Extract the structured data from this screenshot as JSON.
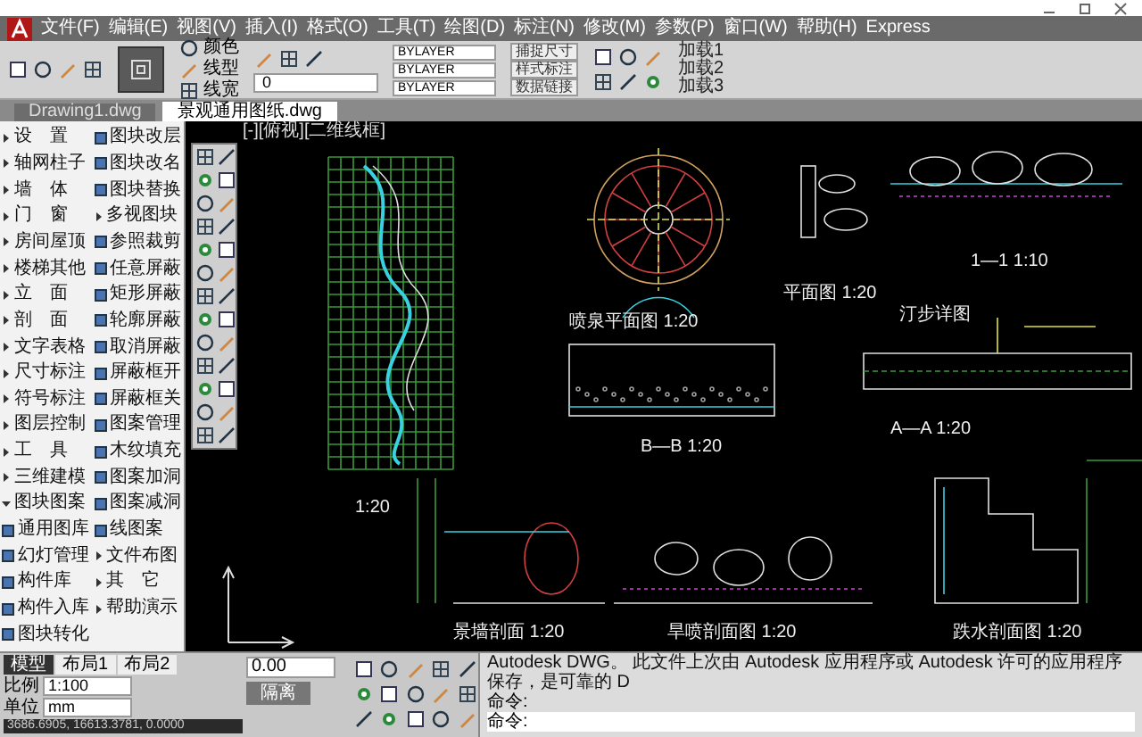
{
  "menu": [
    {
      "label": "文件(F)"
    },
    {
      "label": "编辑(E)"
    },
    {
      "label": "视图(V)"
    },
    {
      "label": "插入(I)"
    },
    {
      "label": "格式(O)"
    },
    {
      "label": "工具(T)"
    },
    {
      "label": "绘图(D)"
    },
    {
      "label": "标注(N)"
    },
    {
      "label": "修改(M)"
    },
    {
      "label": "参数(P)"
    },
    {
      "label": "窗口(W)"
    },
    {
      "label": "帮助(H)"
    },
    {
      "label": "Express"
    }
  ],
  "toolbar": {
    "properties": [
      "颜色",
      "线型",
      "线宽"
    ],
    "layer": "0",
    "linetypes": [
      "BYLAYER",
      "BYLAYER",
      "BYLAYER"
    ],
    "dim_buttons": [
      "捕捉尺寸",
      "样式标注",
      "数据链接"
    ],
    "loads": [
      "加载1",
      "加载2",
      "加载3"
    ]
  },
  "doc_tabs": [
    {
      "label": "Drawing1.dwg",
      "selected": false
    },
    {
      "label": "景观通用图纸.dwg",
      "selected": true
    }
  ],
  "viewport_label": "[-][俯视][二维线框]",
  "sidebar": {
    "items": [
      {
        "label": "设　置",
        "kind": "menu",
        "expanded": false
      },
      {
        "label": "轴网柱子",
        "kind": "menu",
        "expanded": false
      },
      {
        "label": "墙　体",
        "kind": "menu",
        "expanded": false
      },
      {
        "label": "门　窗",
        "kind": "menu",
        "expanded": false
      },
      {
        "label": "房间屋顶",
        "kind": "menu",
        "expanded": false
      },
      {
        "label": "楼梯其他",
        "kind": "menu",
        "expanded": false
      },
      {
        "label": "立　面",
        "kind": "menu",
        "expanded": false
      },
      {
        "label": "剖　面",
        "kind": "menu",
        "expanded": false
      },
      {
        "label": "文字表格",
        "kind": "menu",
        "expanded": false
      },
      {
        "label": "尺寸标注",
        "kind": "menu",
        "expanded": false
      },
      {
        "label": "符号标注",
        "kind": "menu",
        "expanded": false
      },
      {
        "label": "图层控制",
        "kind": "menu",
        "expanded": false
      },
      {
        "label": "工　具",
        "kind": "menu",
        "expanded": false
      },
      {
        "label": "三维建模",
        "kind": "menu",
        "expanded": false
      },
      {
        "label": "图块图案",
        "kind": "menu",
        "expanded": true
      },
      {
        "label": "通用图库",
        "kind": "command"
      },
      {
        "label": "幻灯管理",
        "kind": "command"
      },
      {
        "label": "构件库",
        "kind": "command"
      },
      {
        "label": "构件入库",
        "kind": "command"
      },
      {
        "label": "图块转化",
        "kind": "command"
      },
      {
        "label": "图块改层",
        "kind": "command"
      },
      {
        "label": "图块改名",
        "kind": "command"
      },
      {
        "label": "图块替换",
        "kind": "command"
      },
      {
        "label": "多视图块",
        "kind": "menu",
        "expanded": false
      },
      {
        "label": "参照裁剪",
        "kind": "command"
      },
      {
        "label": "任意屏蔽",
        "kind": "command"
      },
      {
        "label": "矩形屏蔽",
        "kind": "command"
      },
      {
        "label": "轮廓屏蔽",
        "kind": "command"
      },
      {
        "label": "取消屏蔽",
        "kind": "command"
      },
      {
        "label": "屏蔽框开",
        "kind": "command"
      },
      {
        "label": "屏蔽框关",
        "kind": "command"
      },
      {
        "label": "图案管理",
        "kind": "command"
      },
      {
        "label": "木纹填充",
        "kind": "command"
      },
      {
        "label": "图案加洞",
        "kind": "command"
      },
      {
        "label": "图案减洞",
        "kind": "command"
      },
      {
        "label": "线图案",
        "kind": "command"
      },
      {
        "label": "文件布图",
        "kind": "menu",
        "expanded": false
      },
      {
        "label": "其　它",
        "kind": "menu",
        "expanded": false
      },
      {
        "label": "帮助演示",
        "kind": "menu",
        "expanded": false
      }
    ]
  },
  "drawing_labels": [
    "喷泉平面图 1:20",
    "平面图 1:20",
    "1—1 1:10",
    "汀步详图",
    "B—B 1:20",
    "A—A 1:20",
    "1:20",
    "景墙剖面 1:20",
    "旱喷剖面图 1:20",
    "跌水剖面图 1:20"
  ],
  "layout_tabs": [
    {
      "label": "模型",
      "selected": true
    },
    {
      "label": "布局1",
      "selected": false
    },
    {
      "label": "布局2",
      "selected": false
    }
  ],
  "scale": {
    "label": "比例",
    "value": "1:100"
  },
  "unit": {
    "label": "单位",
    "value": "mm"
  },
  "coordinates": "3686.6905, 16613.3781, 0.0000",
  "elevation": "0.00",
  "isolate_button": "隔离",
  "command": {
    "message": "Autodesk DWG。 此文件上次由 Autodesk 应用程序或 Autodesk 许可的应用程序保存，是可靠的 D",
    "history": [
      "命令:",
      "命令:"
    ]
  }
}
